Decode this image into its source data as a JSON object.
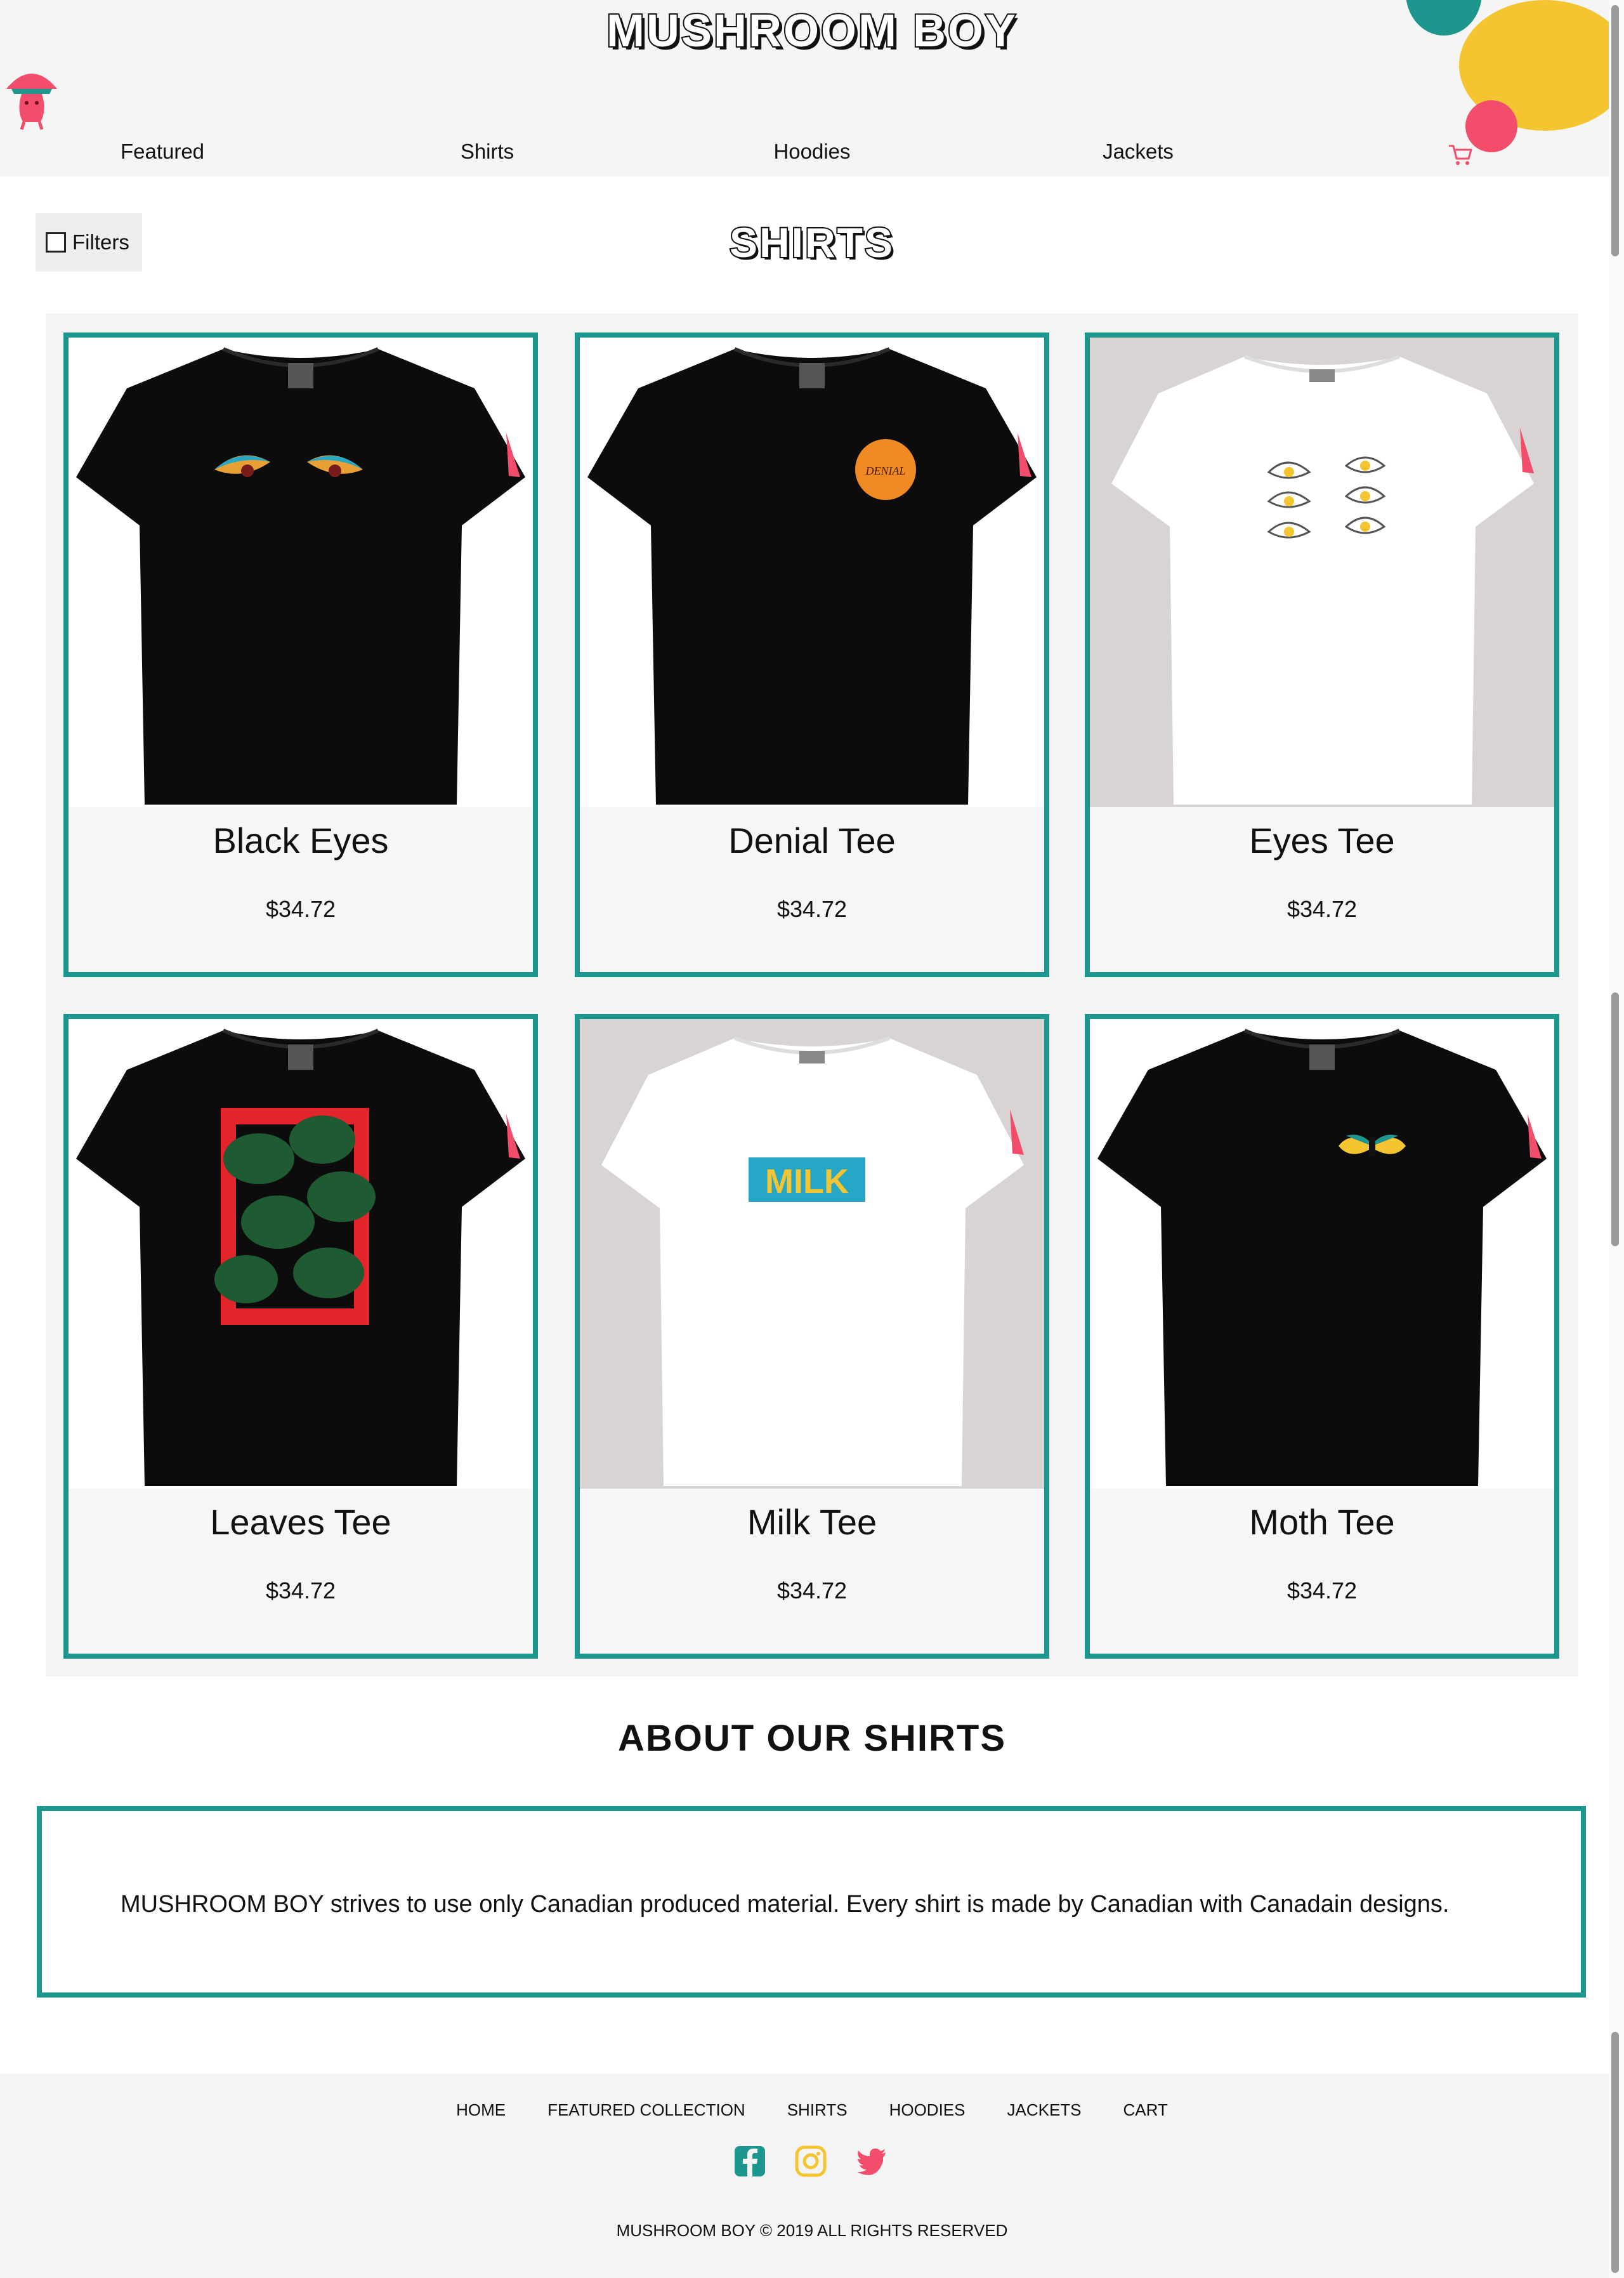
{
  "brand": {
    "name": "MUSHROOM BOY"
  },
  "nav": {
    "items": [
      "Featured",
      "Shirts",
      "Hoodies",
      "Jackets"
    ],
    "cart_icon": "shopping-cart-icon"
  },
  "page": {
    "title": "SHIRTS",
    "filters_label": "Filters"
  },
  "products": [
    {
      "name": "Black Eyes",
      "price": "$34.72",
      "shirt_color": "black",
      "background": "white",
      "graphic": "eyes"
    },
    {
      "name": "Denial Tee",
      "price": "$34.72",
      "shirt_color": "black",
      "background": "white",
      "graphic": "denial-badge",
      "graphic_text": "DENIAL"
    },
    {
      "name": "Eyes Tee",
      "price": "$34.72",
      "shirt_color": "white",
      "background": "grey",
      "graphic": "six-eyes"
    },
    {
      "name": "Leaves Tee",
      "price": "$34.72",
      "shirt_color": "black",
      "background": "white",
      "graphic": "leaves-frame"
    },
    {
      "name": "Milk Tee",
      "price": "$34.72",
      "shirt_color": "white",
      "background": "grey",
      "graphic": "milk-box",
      "graphic_text": "MILK"
    },
    {
      "name": "Moth Tee",
      "price": "$34.72",
      "shirt_color": "black",
      "background": "white",
      "graphic": "moth"
    }
  ],
  "about": {
    "title": "ABOUT OUR SHIRTS",
    "text": "MUSHROOM BOY strives to use only Canadian produced material. Every shirt is made by Canadian with Canadain designs."
  },
  "footer": {
    "links": [
      "HOME",
      "FEATURED COLLECTION",
      "SHIRTS",
      "HOODIES",
      "JACKETS",
      "CART"
    ],
    "social_icons": [
      "facebook-icon",
      "instagram-icon",
      "twitter-icon"
    ],
    "copyright": "MUSHROOM BOY © 2019 ALL RIGHTS RESERVED"
  },
  "colors": {
    "accent_teal": "#1d968e",
    "accent_yellow": "#f5c431",
    "accent_pink": "#f24d6a",
    "header_bg": "#f5f5f5"
  }
}
